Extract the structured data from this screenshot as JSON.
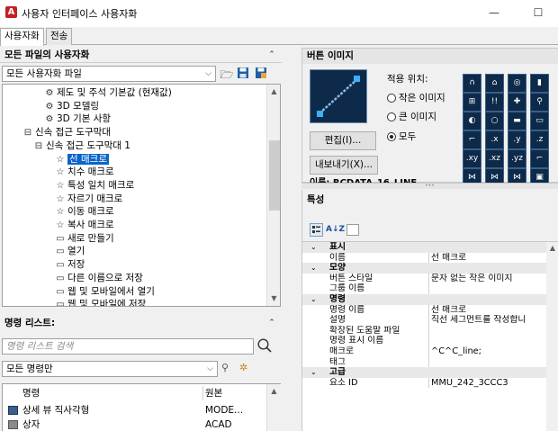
{
  "window": {
    "title": "사용자 인터페이스 사용자화",
    "minimize": "—",
    "maximize": "☐"
  },
  "tabs": [
    {
      "label": "사용자화"
    },
    {
      "label": "전송"
    }
  ],
  "all_files_panel": {
    "title": "모든 파일의 사용자화",
    "combo_value": "모든 사용자화 파일",
    "tree": [
      {
        "icon": "gear-icon",
        "label": "제도 및 주석 기본값 (현재값)"
      },
      {
        "icon": "gear-icon",
        "label": "3D 모델링"
      },
      {
        "icon": "gear-icon",
        "label": "3D 기본 사항"
      },
      {
        "icon": "toolbar-icon",
        "label": "신속 접근 도구막대"
      },
      {
        "icon": "toolbar-icon",
        "label": "신속 접근 도구막대 1"
      },
      {
        "icon": "star-icon",
        "label": "선 매크로"
      },
      {
        "icon": "star-icon",
        "label": "치수 매크로"
      },
      {
        "icon": "star-icon",
        "label": "특성 일치 매크로"
      },
      {
        "icon": "star-icon",
        "label": "자르기 매크로"
      },
      {
        "icon": "star-icon",
        "label": "이동 매크로"
      },
      {
        "icon": "star-icon",
        "label": "복사 매크로"
      },
      {
        "icon": "new-file-icon",
        "label": "새로 만들기"
      },
      {
        "icon": "open-file-icon",
        "label": "열기"
      },
      {
        "icon": "save-icon",
        "label": "저장"
      },
      {
        "icon": "save-as-icon",
        "label": "다른 이름으로 저장"
      },
      {
        "icon": "web-open-icon",
        "label": "웹 및 모바일에서 열기"
      },
      {
        "icon": "web-save-icon",
        "label": "웹 및 모바일에 저장"
      }
    ]
  },
  "command_list": {
    "title": "명령 리스트:",
    "search_placeholder": "명령 리스트 검색",
    "filter_value": "모든 명령만",
    "col_command": "명령",
    "col_source": "원본",
    "rows": [
      {
        "name": "상세 뷰 직사각형",
        "source": "MODE..."
      },
      {
        "name": "상자",
        "source": "ACAD"
      }
    ]
  },
  "button_image": {
    "title": "버튼 이미지",
    "apply_label": "적용 위치:",
    "radio_small": "작은 이미지",
    "radio_large": "큰 이미지",
    "radio_all": "모두",
    "edit_button": "편집(I)...",
    "export_button": "내보내기(X)...",
    "cut_text": "이름: RCDATA_16_LINE"
  },
  "properties": {
    "title": "특성",
    "sort_icon_text": "A↓Z",
    "categories": [
      {
        "name": "표시",
        "rows": [
          {
            "k": "이름",
            "v": "선 매크로"
          }
        ]
      },
      {
        "name": "모양",
        "rows": [
          {
            "k": "버튼 스타일",
            "v": "문자 없는 작은 이미지"
          },
          {
            "k": "그룹 이름",
            "v": ""
          }
        ]
      },
      {
        "name": "명령",
        "rows": [
          {
            "k": "명령 이름",
            "v": "선 매크로"
          },
          {
            "k": "설명",
            "v": "직선 세그먼트를 작성합니"
          },
          {
            "k": "확장된 도움말 파일",
            "v": ""
          },
          {
            "k": "명령 표시 이름",
            "v": ""
          },
          {
            "k": "매크로",
            "v": "^C^C_line;"
          },
          {
            "k": "태그",
            "v": ""
          }
        ]
      },
      {
        "name": "고급",
        "rows": [
          {
            "k": "요소 ID",
            "v": "MMU_242_3CCC3"
          }
        ]
      }
    ]
  },
  "colors": {
    "accent": "#0a64c8",
    "icon_bg": "#0d2a4a"
  }
}
